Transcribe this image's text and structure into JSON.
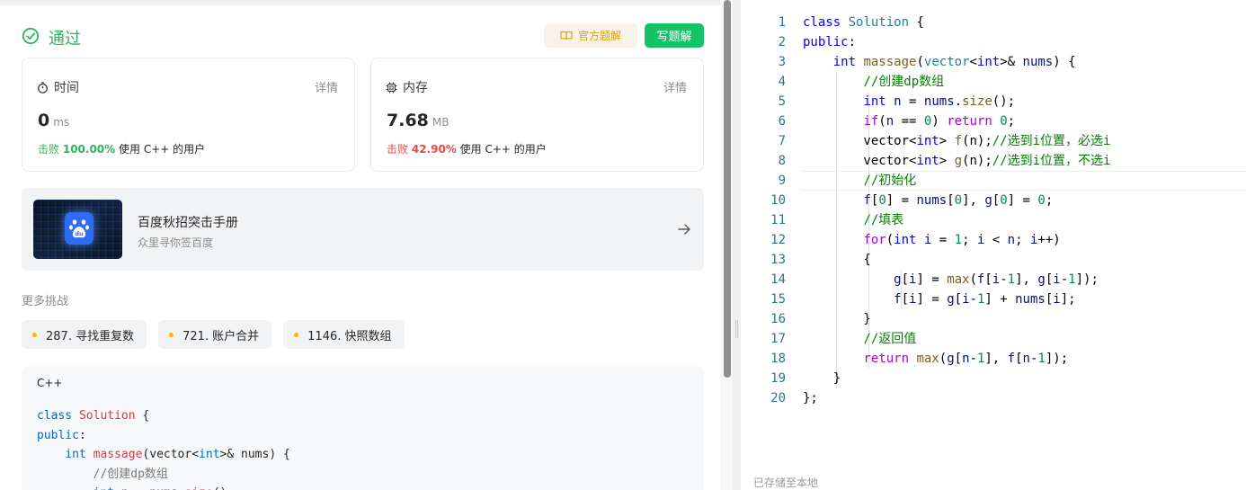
{
  "status": {
    "text": "通过"
  },
  "buttons": {
    "official_solution": "官方题解",
    "write_solution": "写题解"
  },
  "time_card": {
    "title": "时间",
    "detail": "详情",
    "value": "0",
    "unit": "ms",
    "beat_prefix": "击败",
    "beat_value": "100.00%",
    "beat_suffix": "使用 C++ 的用户"
  },
  "memory_card": {
    "title": "内存",
    "detail": "详情",
    "value": "7.68",
    "unit": "MB",
    "beat_prefix": "击败",
    "beat_value": "42.90%",
    "beat_suffix": "使用 C++ 的用户"
  },
  "promo": {
    "title": "百度秋招突击手册",
    "subtitle": "众里寻你签百度",
    "logo_text": "du"
  },
  "more": {
    "title": "更多挑战",
    "chips": [
      "287. 寻找重复数",
      "721. 账户合并",
      "1146. 快照数组"
    ]
  },
  "submission": {
    "language": "C++"
  },
  "editor": {
    "line_numbers": [
      "1",
      "2",
      "3",
      "4",
      "5",
      "6",
      "7",
      "8",
      "9",
      "10",
      "11",
      "12",
      "13",
      "14",
      "15",
      "16",
      "17",
      "18",
      "19",
      "20"
    ],
    "saved_text": "已存储至本地"
  },
  "colors": {
    "accent_green": "#2db55d",
    "beat_red": "#ef4743",
    "write_button": "#12c466",
    "official_text": "#e1a100"
  }
}
